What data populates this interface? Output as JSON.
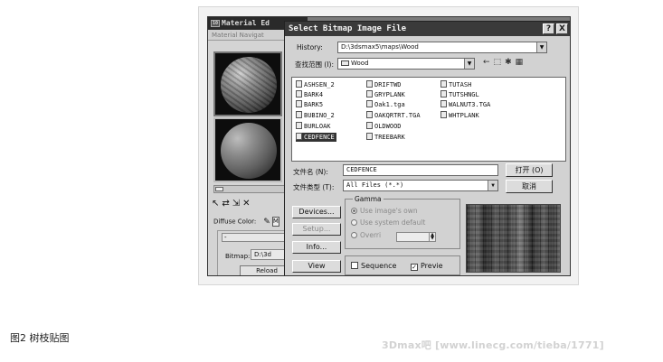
{
  "material_editor": {
    "title": "Material Ed",
    "menu": "Material  Navigat",
    "diffuse_label": "Diffuse Color:",
    "diffuse_m": "M",
    "panel_minus": "-",
    "bitmap_label": "Bitmap:",
    "bitmap_value": "D:\\3d",
    "reload_label": "Reload"
  },
  "dialog": {
    "title": "Select Bitmap Image File",
    "help": "?",
    "close": "X",
    "history_label": "History:",
    "history_value": "D:\\3dsmax5\\maps\\Wood",
    "look_in_label": "查找范围 (I):",
    "look_in_value": "Wood",
    "files": [
      "ASHSEN_2",
      "BARK4",
      "BARK5",
      "BUBINO_2",
      "BURLOAK",
      "CEDFENCE",
      "DRIFTWD",
      "GRYPLANK",
      "Oak1.tga",
      "OAKQRTRT.TGA",
      "OLDWOOD",
      "TREEBARK",
      "TUTASH",
      "TUTSHNGL",
      "WALNUT3.TGA",
      "WHTPLANK"
    ],
    "selected_file": "CEDFENCE",
    "filename_label": "文件名 (N):",
    "filename_value": "CEDFENCE",
    "filetype_label": "文件类型 (T):",
    "filetype_value": "All Files (*.*)",
    "open_button": "打开 (O)",
    "cancel_button": "取消",
    "devices_button": "Devices...",
    "setup_button": "Setup...",
    "info_button": "Info...",
    "view_button": "View",
    "gamma": {
      "title": "Gamma",
      "use_own": "Use image's own",
      "use_default": "Use system default",
      "override": "Overri"
    },
    "sequence_label": "Sequence",
    "preview_label": "Previe"
  },
  "caption": "图2 树枝贴图",
  "watermark": "3Dmax吧 [www.linecg.com/tieba/1771]"
}
